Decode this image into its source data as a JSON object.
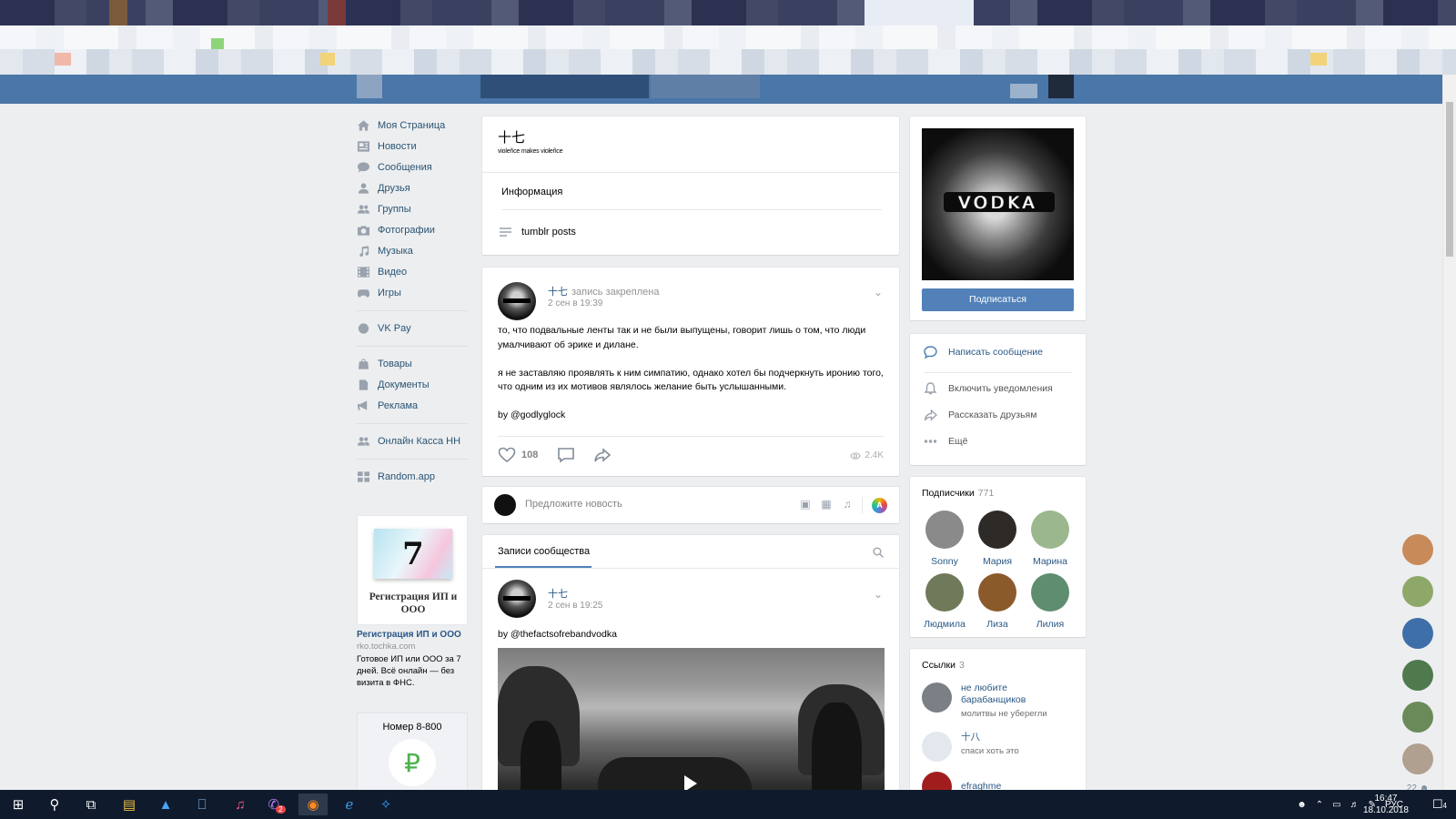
{
  "left_menu": {
    "items": [
      {
        "label": "Моя Страница"
      },
      {
        "label": "Новости"
      },
      {
        "label": "Сообщения"
      },
      {
        "label": "Друзья"
      },
      {
        "label": "Группы"
      },
      {
        "label": "Фотографии"
      },
      {
        "label": "Музыка"
      },
      {
        "label": "Видео"
      },
      {
        "label": "Игры"
      },
      {
        "label": "VK Pay"
      },
      {
        "label": "Товары"
      },
      {
        "label": "Документы"
      },
      {
        "label": "Реклама"
      },
      {
        "label": "Онлайн Касса НН"
      },
      {
        "label": "Random.app"
      }
    ]
  },
  "ad": {
    "calendar_day": "7",
    "image_caption": "Регистрация ИП и ООО",
    "title": "Регистрация ИП и ООО",
    "domain": "rko.tochka.com",
    "description": "Готовое ИП или ООО за 7 дней. Всё онлайн — без визита в ФНС."
  },
  "ad2": {
    "title": "Номер 8-800",
    "icon_symbol": "₽"
  },
  "group": {
    "name": "十七",
    "status": "violeñce makes violeñce",
    "info_label": "Информация",
    "tumblr_label": "tumblr posts"
  },
  "pinned_post": {
    "author": "十七",
    "pinned_label": "запись закреплена",
    "date": "2 сен в 19:39",
    "paragraphs": [
      "то, что подвальные ленты так и не были выпущены, говорит лишь о том, что люди умалчивают об эрике и дилане.",
      "я не заставляю проявлять к ним симпатию, однако хотел бы подчеркнуть иронию того, что одним из их мотивов являлось желание быть услышанными.",
      "by @godlyglock"
    ],
    "likes": "108",
    "views": "2.4K"
  },
  "suggest": {
    "placeholder": "Предложите новость",
    "color_badge": "A"
  },
  "feed": {
    "tab_label": "Записи сообщества",
    "post": {
      "author": "十七",
      "date": "2 сен в 19:25",
      "text": "by @thefactsofrebandvodka"
    }
  },
  "cover": {
    "title": "VODKA",
    "subscribe_label": "Подписаться"
  },
  "right_actions": {
    "message": "Написать сообщение",
    "notify": "Включить уведомления",
    "share": "Рассказать друзьям",
    "more": "Ещё"
  },
  "subscribers": {
    "title": "Подписчики",
    "count": "771",
    "people": [
      {
        "name": "Sonny",
        "color": "#8a8a8a"
      },
      {
        "name": "Мария",
        "color": "#2e2a28"
      },
      {
        "name": "Марина",
        "color": "#9bb78e"
      },
      {
        "name": "Людмила",
        "color": "#6f7a5a"
      },
      {
        "name": "Лиза",
        "color": "#8b5a2b"
      },
      {
        "name": "Лилия",
        "color": "#5f8d6f"
      }
    ]
  },
  "links": {
    "title": "Ссылки",
    "count": "3",
    "items": [
      {
        "title": "не любите барабанщиков",
        "desc": "молитвы не уберегли",
        "color": "#7b7f86"
      },
      {
        "title": "十八",
        "desc": "спаси хоть это",
        "color": "#e3e8ef"
      },
      {
        "title": "efraghme",
        "desc": "",
        "color": "#a11d1d"
      }
    ]
  },
  "friends_strip": {
    "avatars": [
      "#c98a5a",
      "#8ea86a",
      "#3f6fa8",
      "#4e7a4e",
      "#6a8a5a",
      "#b0a090"
    ],
    "count": "22"
  },
  "taskbar": {
    "lang": "РУС",
    "time": "16:47",
    "date": "18.10.2018",
    "notifications": "4",
    "badge": "2"
  }
}
